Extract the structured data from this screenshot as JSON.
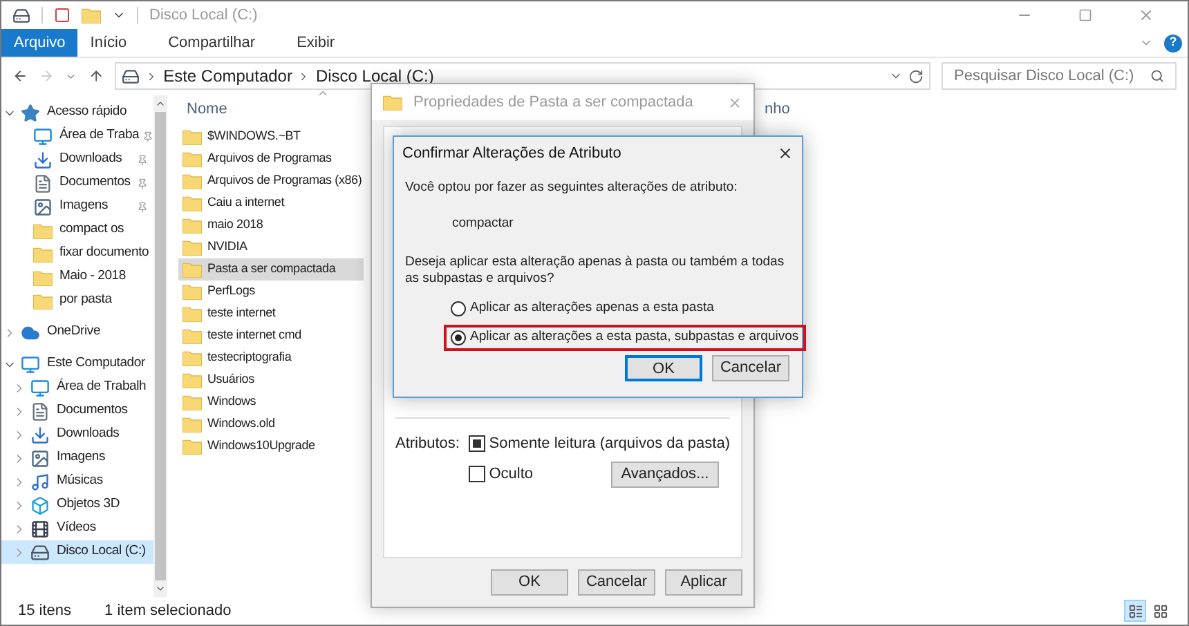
{
  "window": {
    "title": "Disco Local (C:)"
  },
  "ribbon_tabs": [
    {
      "label": "Arquivo",
      "selected": true
    },
    {
      "label": "Início",
      "selected": false
    },
    {
      "label": "Compartilhar",
      "selected": false
    },
    {
      "label": "Exibir",
      "selected": false
    }
  ],
  "help_button": "?",
  "address": {
    "breadcrumbs": [
      "Este Computador",
      "Disco Local (C:)"
    ]
  },
  "search": {
    "placeholder": "Pesquisar Disco Local (C:)"
  },
  "sidebar": {
    "items": [
      {
        "label": "Acesso rápido",
        "kind": "star",
        "expanded": true,
        "selected": false,
        "children": [
          {
            "label": "Área de Traba",
            "kind": "desktop",
            "pinned": true,
            "selected": false
          },
          {
            "label": "Downloads",
            "kind": "download",
            "pinned": true,
            "selected": false
          },
          {
            "label": "Documentos",
            "kind": "document",
            "pinned": true,
            "selected": false
          },
          {
            "label": "Imagens",
            "kind": "image",
            "pinned": true,
            "selected": false
          },
          {
            "label": "compact os",
            "kind": "folder",
            "pinned": false,
            "selected": false
          },
          {
            "label": "fixar documento",
            "kind": "folder",
            "pinned": false,
            "selected": false
          },
          {
            "label": "Maio - 2018",
            "kind": "folder",
            "pinned": false,
            "selected": false
          },
          {
            "label": "por pasta",
            "kind": "folder",
            "pinned": false,
            "selected": false
          }
        ]
      },
      {
        "label": "OneDrive",
        "kind": "cloud",
        "expanded": false,
        "selected": false
      },
      {
        "label": "Este Computador",
        "kind": "computer",
        "expanded": true,
        "selected": false,
        "children": [
          {
            "label": "Área de Trabalh",
            "kind": "desktop",
            "expanded": false,
            "selected": false
          },
          {
            "label": "Documentos",
            "kind": "document",
            "expanded": false,
            "selected": false
          },
          {
            "label": "Downloads",
            "kind": "download",
            "expanded": false,
            "selected": false
          },
          {
            "label": "Imagens",
            "kind": "image",
            "expanded": false,
            "selected": false
          },
          {
            "label": "Músicas",
            "kind": "music",
            "expanded": false,
            "selected": false
          },
          {
            "label": "Objetos 3D",
            "kind": "cube",
            "expanded": false,
            "selected": false
          },
          {
            "label": "Vídeos",
            "kind": "video",
            "expanded": false,
            "selected": false
          },
          {
            "label": "Disco Local (C:)",
            "kind": "drive",
            "expanded": false,
            "selected": true
          }
        ]
      }
    ]
  },
  "file_list": {
    "columns": [
      "Nome",
      "nho"
    ],
    "rows": [
      {
        "name": "$WINDOWS.~BT",
        "selected": false
      },
      {
        "name": "Arquivos de Programas",
        "selected": false
      },
      {
        "name": "Arquivos de Programas (x86)",
        "selected": false
      },
      {
        "name": "Caiu a internet",
        "selected": false
      },
      {
        "name": "maio 2018",
        "selected": false
      },
      {
        "name": "NVIDIA",
        "selected": false
      },
      {
        "name": "Pasta a ser compactada",
        "selected": true
      },
      {
        "name": "PerfLogs",
        "selected": false
      },
      {
        "name": "teste internet",
        "selected": false
      },
      {
        "name": "teste internet cmd",
        "selected": false
      },
      {
        "name": "testecriptografia",
        "selected": false
      },
      {
        "name": "Usuários",
        "selected": false
      },
      {
        "name": "Windows",
        "selected": false
      },
      {
        "name": "Windows.old",
        "selected": false
      },
      {
        "name": "Windows10Upgrade",
        "selected": false
      }
    ]
  },
  "status_bar": {
    "item_count": "15 itens",
    "selection": "1 item selecionado",
    "view_buttons": [
      {
        "kind": "details",
        "selected": true
      },
      {
        "kind": "tiles",
        "selected": false
      }
    ]
  },
  "properties_dialog": {
    "title": "Propriedades de Pasta a ser compactada",
    "attributes_label": "Atributos:",
    "checkboxes": [
      {
        "label": "Somente leitura (arquivos da pasta)",
        "kind": "mixed"
      },
      {
        "label": "Oculto",
        "kind": "box",
        "checked": false
      }
    ],
    "advanced_button": "Avançados...",
    "buttons": [
      "OK",
      "Cancelar",
      "Aplicar"
    ]
  },
  "confirm_dialog": {
    "title": "Confirmar Alterações de Atributo",
    "message": "Você optou por fazer as seguintes alterações de atributo:",
    "change": "compactar",
    "question": "Deseja aplicar esta alteração apenas à pasta ou também a todas as subpastas e arquivos?",
    "options": [
      {
        "label": "Aplicar as alterações apenas a esta pasta",
        "selected": false,
        "highlighted": false
      },
      {
        "label": "Aplicar as alterações a esta pasta, subpastas e arquivos",
        "selected": true,
        "highlighted": true
      }
    ],
    "buttons": [
      {
        "label": "OK",
        "focused": true
      },
      {
        "label": "Cancelar",
        "focused": false
      }
    ]
  }
}
